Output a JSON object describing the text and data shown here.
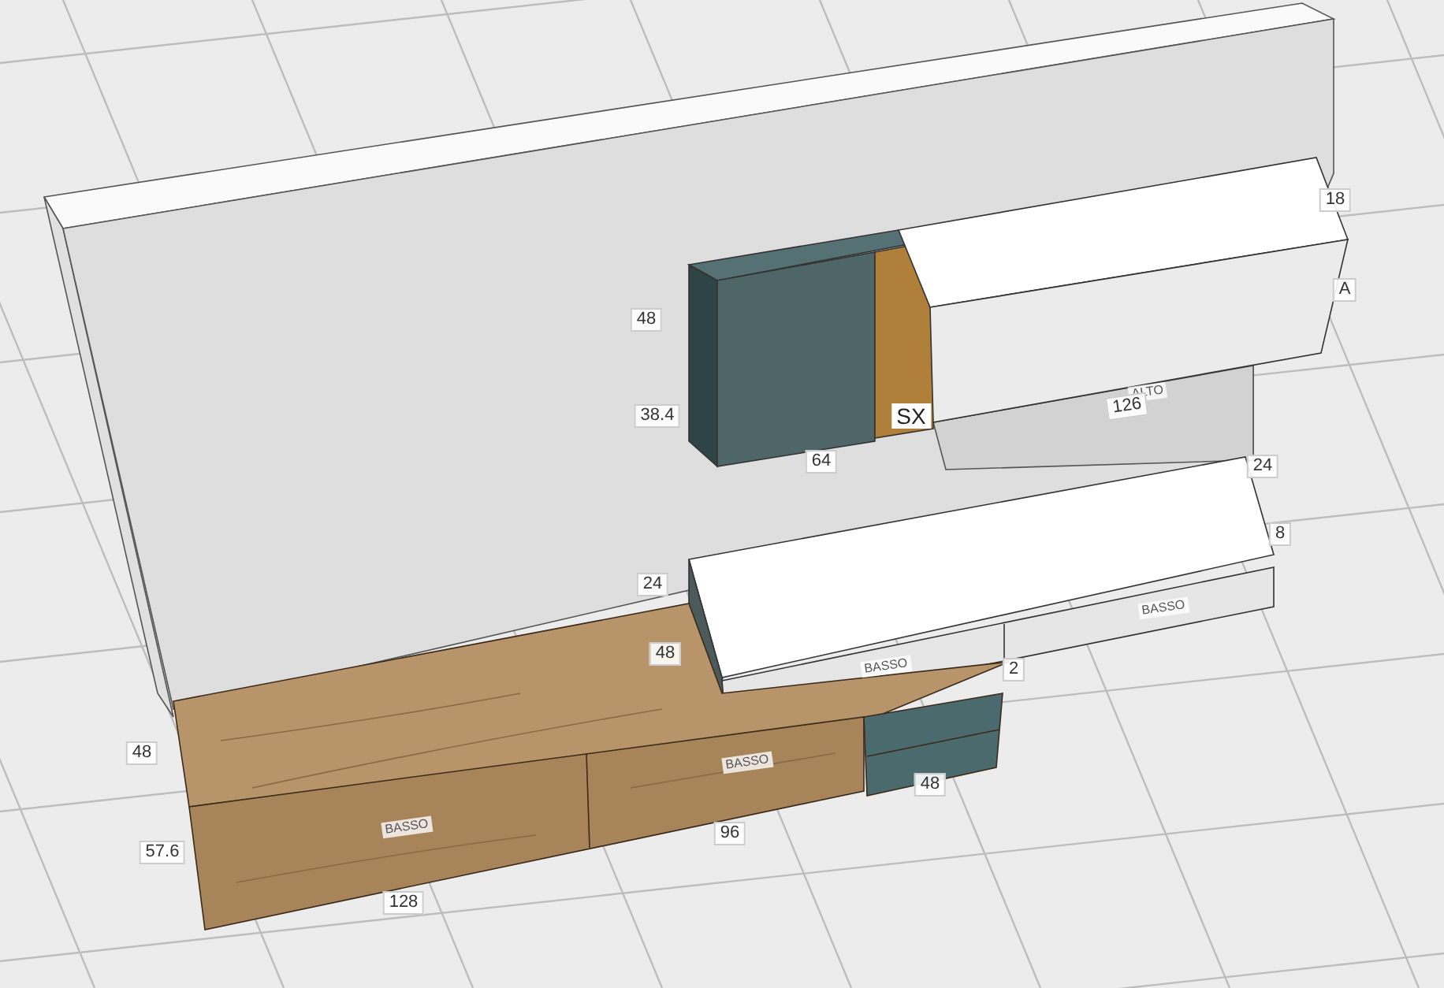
{
  "labels": [
    {
      "text": "48",
      "kind": "dimension"
    },
    {
      "text": "38.4",
      "kind": "dimension"
    },
    {
      "text": "SX",
      "kind": "side"
    },
    {
      "text": "ALTO",
      "kind": "module"
    },
    {
      "text": "126",
      "kind": "dimension"
    },
    {
      "text": "64",
      "kind": "dimension"
    },
    {
      "text": "18",
      "kind": "dimension"
    },
    {
      "text": "A",
      "kind": "dimension"
    },
    {
      "text": "24",
      "kind": "dimension"
    },
    {
      "text": "8",
      "kind": "dimension"
    },
    {
      "text": "24",
      "kind": "dimension"
    },
    {
      "text": "48",
      "kind": "dimension"
    },
    {
      "text": "BASSO",
      "kind": "module"
    },
    {
      "text": "BASSO",
      "kind": "module"
    },
    {
      "text": "2",
      "kind": "dimension"
    },
    {
      "text": "48",
      "kind": "dimension"
    },
    {
      "text": "BASSO",
      "kind": "module"
    },
    {
      "text": "BASSO",
      "kind": "module"
    },
    {
      "text": "57.6",
      "kind": "dimension"
    },
    {
      "text": "96",
      "kind": "dimension"
    },
    {
      "text": "48",
      "kind": "dimension"
    },
    {
      "text": "128",
      "kind": "dimension"
    }
  ]
}
